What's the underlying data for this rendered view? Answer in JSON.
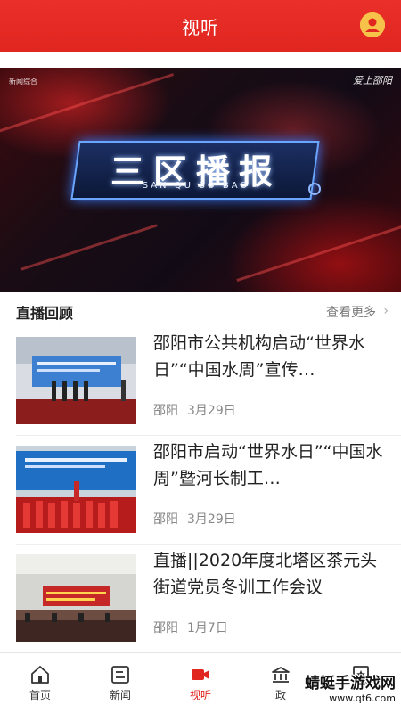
{
  "header": {
    "title": "视听",
    "avatar_icon": "user-avatar-icon",
    "accent": "#e0261f"
  },
  "video": {
    "logo_left": "新闻综合",
    "logo_right": "爱上邵阳",
    "banner_title": "三区播报",
    "banner_subtitle": "SAN QU BO BAO"
  },
  "section": {
    "title": "直播回顾",
    "more_label": "查看更多",
    "more_icon": "chevron-right-icon"
  },
  "news": [
    {
      "title": "邵阳市公共机构启动“世界水日”“中国水周”宣传…",
      "source": "邵阳",
      "date": "3月29日"
    },
    {
      "title": "邵阳市启动“世界水日”“中国水周”暨河长制工…",
      "source": "邵阳",
      "date": "3月29日"
    },
    {
      "title": "直播||2020年度北塔区茶元头街道党员冬训工作会议",
      "source": "邵阳",
      "date": "1月7日"
    }
  ],
  "tabs": [
    {
      "label": "首页",
      "icon": "home-icon"
    },
    {
      "label": "新闻",
      "icon": "news-icon"
    },
    {
      "label": "视听",
      "icon": "video-camera-icon",
      "active": true
    },
    {
      "label": "政",
      "icon": "government-building-icon"
    },
    {
      "label": "",
      "icon": "star-badge-icon"
    }
  ],
  "watermark": {
    "title": "蜻蜓手游戏网",
    "url": "www.qt6.com"
  }
}
